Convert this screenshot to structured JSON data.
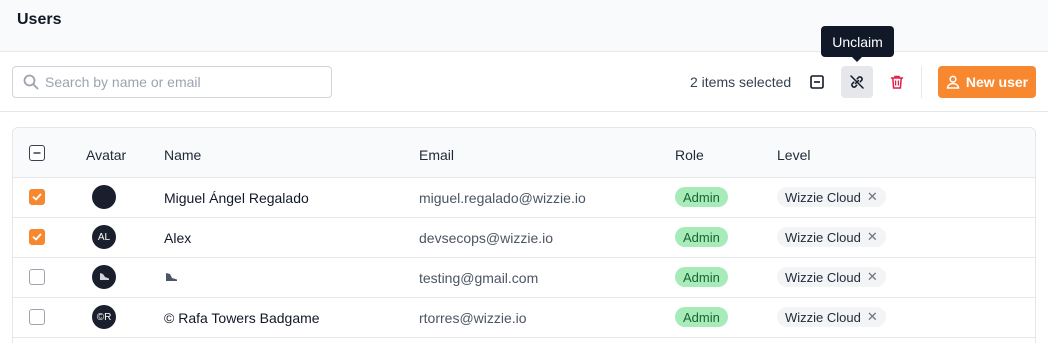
{
  "header": {
    "title": "Users"
  },
  "search": {
    "placeholder": "Search by name or email",
    "value": ""
  },
  "toolbar": {
    "selected_count_text": "2 items selected",
    "tooltip": "Unclaim",
    "new_user_label": "New user",
    "accent_color": "#f7882f",
    "delete_color": "#e11d48"
  },
  "table": {
    "columns": [
      "Avatar",
      "Name",
      "Email",
      "Role",
      "Level"
    ],
    "header_checkbox_state": "indeterminate",
    "rows": [
      {
        "checked": true,
        "avatar": "",
        "name": "Miguel Ángel Regalado",
        "email": "miguel.regalado@wizzie.io",
        "role": "Admin",
        "level": "Wizzie Cloud"
      },
      {
        "checked": true,
        "avatar": "AL",
        "name": "Alex",
        "email": "devsecops@wizzie.io",
        "role": "Admin",
        "level": "Wizzie Cloud"
      },
      {
        "checked": false,
        "avatar": "",
        "name": "",
        "email": "testing@gmail.com",
        "role": "Admin",
        "level": "Wizzie Cloud"
      },
      {
        "checked": false,
        "avatar": "©R",
        "name": "© Rafa Towers Badgame",
        "email": "rtorres@wizzie.io",
        "role": "Admin",
        "level": "Wizzie Cloud"
      }
    ]
  }
}
